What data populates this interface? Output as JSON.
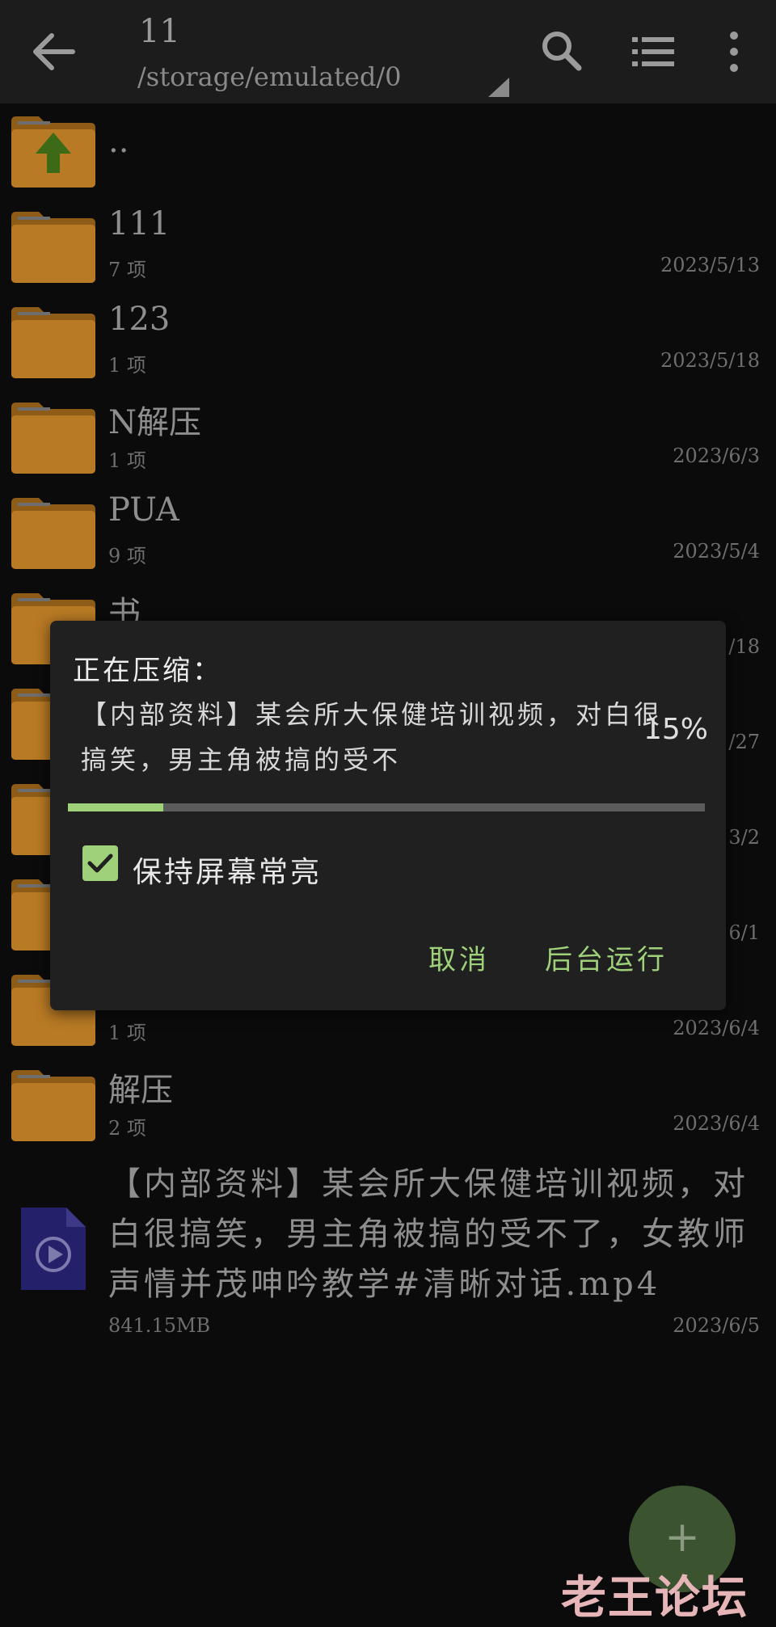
{
  "appbar": {
    "title": "11",
    "path": "/storage/emulated/0",
    "back_icon": "arrow-left-icon",
    "search_icon": "search-icon",
    "list_icon": "list-view-icon",
    "more_icon": "more-vert-icon"
  },
  "parent": {
    "name": ".."
  },
  "folders": [
    {
      "name": "111",
      "meta": "7 项",
      "date": "2023/5/13"
    },
    {
      "name": "123",
      "meta": "1 项",
      "date": "2023/5/18"
    },
    {
      "name": "N解压",
      "meta": "1 项",
      "date": "2023/6/3"
    },
    {
      "name": "PUA",
      "meta": "9 项",
      "date": "2023/5/4"
    },
    {
      "name": "书",
      "meta": "",
      "date": "/18"
    },
    {
      "name": "",
      "meta": "",
      "date": "/27"
    },
    {
      "name": "",
      "meta": "",
      "date": "3/2"
    },
    {
      "name": "",
      "meta": "",
      "date": "6/1"
    },
    {
      "name": "",
      "meta": "1 项",
      "date": "2023/6/4"
    },
    {
      "name": "解压",
      "meta": "2 项",
      "date": "2023/6/4"
    }
  ],
  "file": {
    "name": "【内部资料】某会所大保健培训视频，对白很搞笑，男主角被搞的受不了，女教师声情并茂呻吟教学#清晰对话.mp4",
    "size": "841.15MB",
    "date": "2023/6/5"
  },
  "dialog": {
    "title": "正在压缩：",
    "filename": "【内部资料】某会所大保健培训视频，对白很搞笑，男主角被搞的受不",
    "percent_label": "15%",
    "progress": 0.15,
    "keep_screen_label": "保持屏幕常亮",
    "keep_screen_checked": true,
    "cancel_label": "取消",
    "background_label": "后台运行"
  },
  "fab": {
    "label": "+"
  },
  "watermark": "老王论坛",
  "colors": {
    "accent": "#9fd07a",
    "folder": "#b87a24",
    "folder_dark": "#8e5c17",
    "fab": "#3c5330"
  }
}
